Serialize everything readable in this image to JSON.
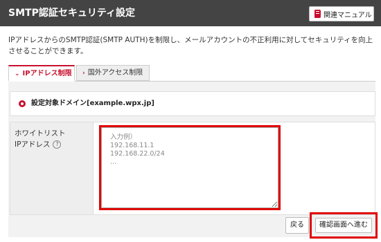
{
  "header": {
    "title": "SMTP認証セキュリティ設定",
    "manual_button": {
      "label": "関連マニュアル",
      "icon": "book-icon"
    }
  },
  "description": "IPアドレスからのSMTP認証(SMTP AUTH)を制限し、メールアカウントの不正利用に対してセキュリティを向上させることができます。",
  "tabs": [
    {
      "label": "IPアドレス制限",
      "active": true
    },
    {
      "label": "国外アクセス制限",
      "active": false
    }
  ],
  "domain": {
    "label": "設定対象ドメイン[example.wpx.jp]"
  },
  "form": {
    "whitelist_label_line1": "ホワイトリスト",
    "whitelist_label_line2": "IPアドレス",
    "help_icon": "?",
    "textarea_placeholder": "入力例）\n192.168.11.1\n192.168.22.0/24\n..."
  },
  "buttons": {
    "back": "戻る",
    "confirm": "確認画面へ進む"
  },
  "colors": {
    "accent": "#c8102e",
    "header_bg": "#444444",
    "highlight": "#e00000"
  }
}
